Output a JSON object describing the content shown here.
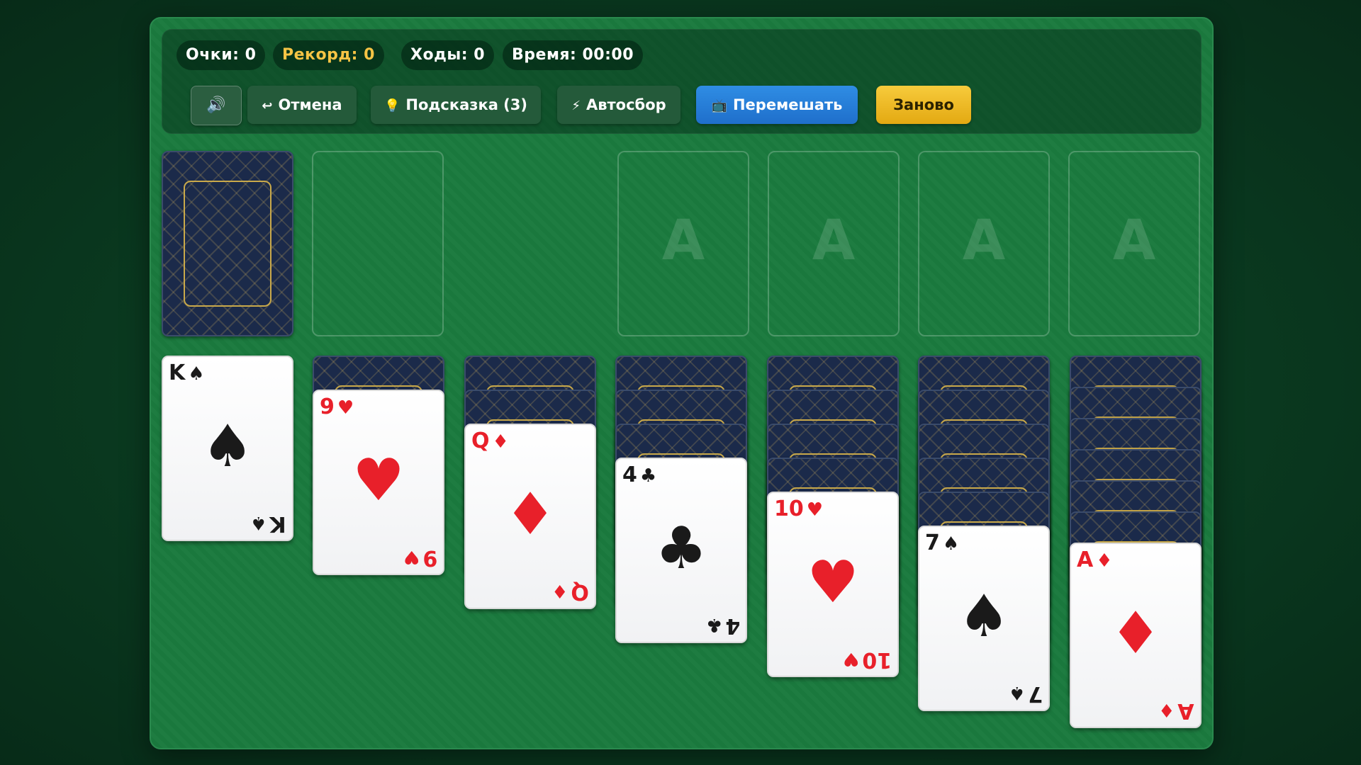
{
  "stats": {
    "score": "Очки: 0",
    "record": "Рекорд: 0",
    "moves": "Ходы: 0",
    "time": "Время: 00:00"
  },
  "buttons": {
    "sound": "🔊",
    "undo_icon": "↩",
    "undo": "Отмена",
    "hint_icon": "💡",
    "hint": "Подсказка (3)",
    "auto_icon": "⚡",
    "auto": "Автосбор",
    "shuffle_icon": "📺",
    "shuffle": "Перемешать",
    "restart": "Заново"
  },
  "foundations": [
    {
      "placeholder": "A"
    },
    {
      "placeholder": "A"
    },
    {
      "placeholder": "A"
    },
    {
      "placeholder": "A"
    }
  ],
  "tableau": [
    {
      "hidden": 0,
      "top": {
        "rank": "K",
        "suit": "♠",
        "color": "black"
      }
    },
    {
      "hidden": 1,
      "top": {
        "rank": "9",
        "suit": "♥",
        "color": "red"
      }
    },
    {
      "hidden": 2,
      "top": {
        "rank": "Q",
        "suit": "♦",
        "color": "red"
      }
    },
    {
      "hidden": 3,
      "top": {
        "rank": "4",
        "suit": "♣",
        "color": "black"
      }
    },
    {
      "hidden": 4,
      "top": {
        "rank": "10",
        "suit": "♥",
        "color": "red"
      }
    },
    {
      "hidden": 5,
      "top": {
        "rank": "7",
        "suit": "♠",
        "color": "black"
      }
    },
    {
      "hidden": 6,
      "top": {
        "rank": "A",
        "suit": "♦",
        "color": "red"
      }
    }
  ],
  "colors": {
    "felt": "#1a7a3e",
    "card_back": "#1b2a4a",
    "accent_gold": "#f6c445",
    "shuffle_blue": "#2f8de4",
    "red_suit": "#e8202a"
  }
}
